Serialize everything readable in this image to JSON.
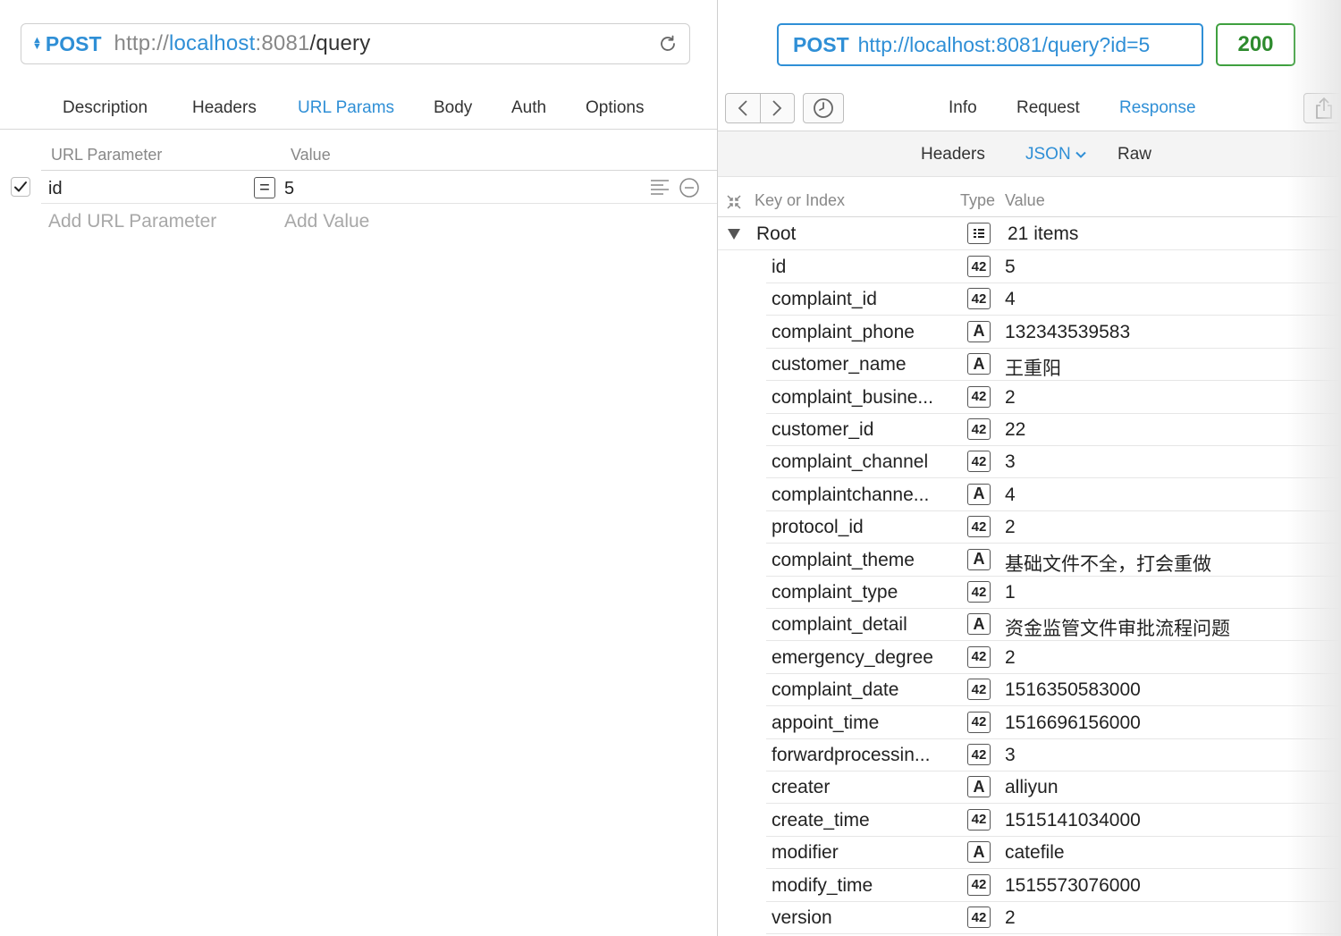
{
  "request": {
    "method": "POST",
    "url_scheme": "http://",
    "url_host": "localhost",
    "url_port": ":8081",
    "url_path": "/query",
    "tabs": [
      "Description",
      "Headers",
      "URL Params",
      "Body",
      "Auth",
      "Options"
    ],
    "active_tab": "URL Params",
    "params_header": {
      "param": "URL Parameter",
      "value": "Value"
    },
    "params": [
      {
        "enabled": true,
        "name": "id",
        "value": "5"
      }
    ],
    "add_param_placeholder": "Add URL Parameter",
    "add_value_placeholder": "Add Value"
  },
  "response": {
    "method": "POST",
    "url": "http://localhost:8081/query?id=5",
    "status": "200",
    "tabs": [
      "Info",
      "Request",
      "Response"
    ],
    "active_tab": "Response",
    "subtabs": [
      "Headers",
      "JSON",
      "Raw"
    ],
    "active_subtab": "JSON",
    "tree_header": {
      "key": "Key or Index",
      "type": "Type",
      "value": "Value"
    },
    "root": {
      "key": "Root",
      "value": "21 items"
    },
    "items": [
      {
        "key": "id",
        "type": "42",
        "value": "5"
      },
      {
        "key": "complaint_id",
        "type": "42",
        "value": "4"
      },
      {
        "key": "complaint_phone",
        "type": "A",
        "value": "132343539583"
      },
      {
        "key": "customer_name",
        "type": "A",
        "value": "王重阳"
      },
      {
        "key": "complaint_busine...",
        "type": "42",
        "value": "2"
      },
      {
        "key": "customer_id",
        "type": "42",
        "value": "22"
      },
      {
        "key": "complaint_channel",
        "type": "42",
        "value": "3"
      },
      {
        "key": "complaintchanne...",
        "type": "A",
        "value": "4"
      },
      {
        "key": "protocol_id",
        "type": "42",
        "value": "2"
      },
      {
        "key": "complaint_theme",
        "type": "A",
        "value": "基础文件不全，打会重做"
      },
      {
        "key": "complaint_type",
        "type": "42",
        "value": "1"
      },
      {
        "key": "complaint_detail",
        "type": "A",
        "value": "资金监管文件审批流程问题"
      },
      {
        "key": "emergency_degree",
        "type": "42",
        "value": "2"
      },
      {
        "key": "complaint_date",
        "type": "42",
        "value": "1516350583000"
      },
      {
        "key": "appoint_time",
        "type": "42",
        "value": "1516696156000"
      },
      {
        "key": "forwardprocessin...",
        "type": "42",
        "value": "3"
      },
      {
        "key": "creater",
        "type": "A",
        "value": "alliyun"
      },
      {
        "key": "create_time",
        "type": "42",
        "value": "1515141034000"
      },
      {
        "key": "modifier",
        "type": "A",
        "value": "catefile"
      },
      {
        "key": "modify_time",
        "type": "42",
        "value": "1515573076000"
      },
      {
        "key": "version",
        "type": "42",
        "value": "2"
      }
    ]
  },
  "colors": {
    "accent": "#2f8fd6",
    "status_ok": "#2e8b2e"
  }
}
